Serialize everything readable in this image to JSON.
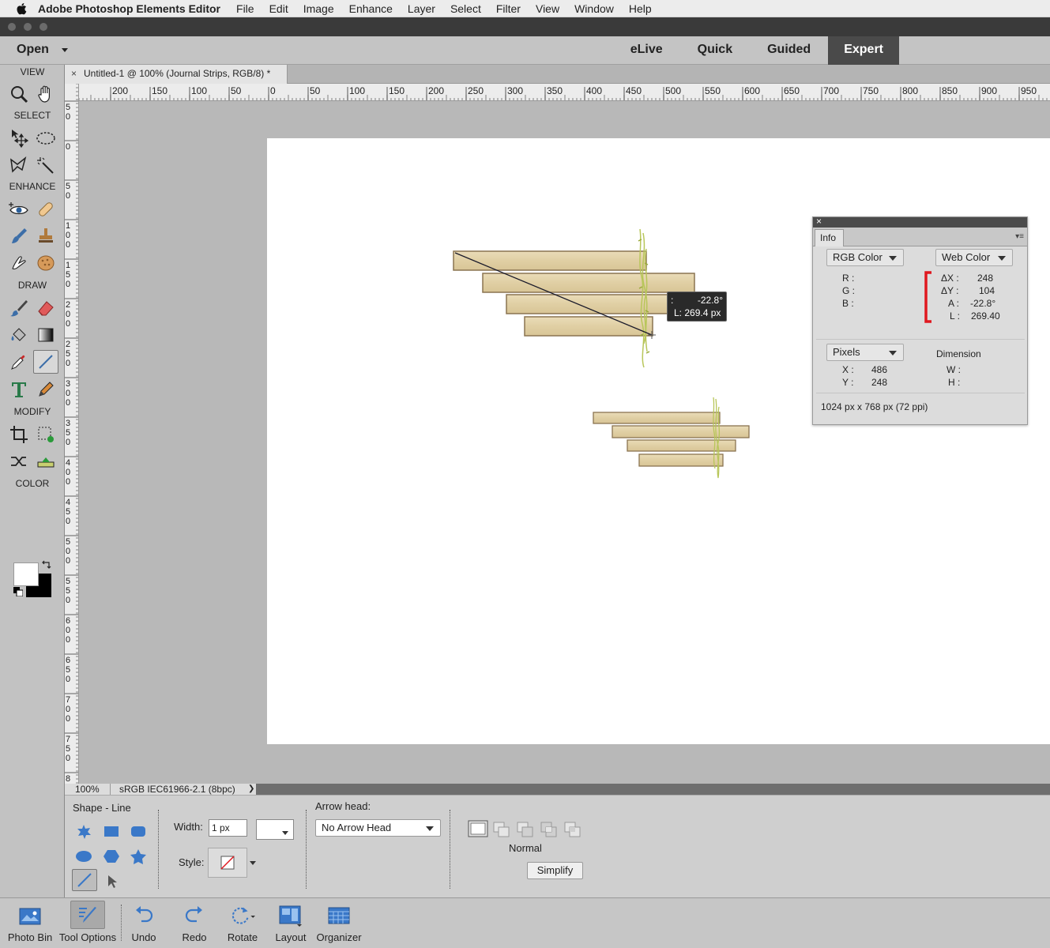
{
  "menubar": {
    "app_name": "Adobe Photoshop Elements Editor",
    "items": [
      "File",
      "Edit",
      "Image",
      "Enhance",
      "Layer",
      "Select",
      "Filter",
      "View",
      "Window",
      "Help"
    ]
  },
  "topbar": {
    "open_label": "Open",
    "modes": [
      "eLive",
      "Quick",
      "Guided",
      "Expert"
    ],
    "active_mode": "Expert"
  },
  "toolbox": {
    "sections": {
      "view": "VIEW",
      "select": "SELECT",
      "enhance": "ENHANCE",
      "draw": "DRAW",
      "modify": "MODIFY",
      "color": "COLOR"
    }
  },
  "document": {
    "tab_label": "Untitled-1 @ 100% (Journal Strips, RGB/8) *"
  },
  "rulers": {
    "horizontal": [
      "200",
      "150",
      "100",
      "50",
      "0",
      "50",
      "100",
      "150",
      "200",
      "250",
      "300",
      "350",
      "400",
      "450",
      "500",
      "550",
      "600",
      "650",
      "700",
      "750",
      "800",
      "850",
      "900",
      "950"
    ],
    "vertical": [
      [
        "5",
        "0"
      ],
      [
        "0"
      ],
      [
        "5",
        "0"
      ],
      [
        "1",
        "0",
        "0"
      ],
      [
        "1",
        "5",
        "0"
      ],
      [
        "2",
        "0",
        "0"
      ],
      [
        "2",
        "5",
        "0"
      ],
      [
        "3",
        "0",
        "0"
      ],
      [
        "3",
        "5",
        "0"
      ],
      [
        "4",
        "0",
        "0"
      ],
      [
        "4",
        "5",
        "0"
      ],
      [
        "5",
        "0",
        "0"
      ],
      [
        "5",
        "5",
        "0"
      ],
      [
        "6",
        "0",
        "0"
      ],
      [
        "6",
        "5",
        "0"
      ],
      [
        "7",
        "0",
        "0"
      ],
      [
        "7",
        "5",
        "0"
      ],
      [
        "8"
      ]
    ]
  },
  "measure_tooltip": {
    "angle": "-22.8°",
    "angle_prefix": ":",
    "length": "L: 269.4 px"
  },
  "info_panel": {
    "tab": "Info",
    "color_mode_1": "RGB Color",
    "color_mode_2": "Web Color",
    "r_label": "R :",
    "g_label": "G :",
    "b_label": "B :",
    "dx_label": "ΔX :",
    "dx_value": "248",
    "dy_label": "ΔY :",
    "dy_value": "104",
    "a_label": "A :",
    "a_value": "-22.8°",
    "l_label": "L :",
    "l_value": "269.40",
    "units": "Pixels",
    "dimension_label": "Dimension",
    "x_label": "X :",
    "x_value": "486",
    "y_label": "Y :",
    "y_value": "248",
    "w_label": "W :",
    "h_label": "H :",
    "doc_size": "1024 px x 768 px (72 ppi)"
  },
  "statusbar": {
    "zoom": "100%",
    "profile": "sRGB IEC61966-2.1 (8bpc)"
  },
  "tool_options": {
    "title": "Shape - Line",
    "width_label": "Width:",
    "width_value": "1 px",
    "style_label": "Style:",
    "arrow_head_label": "Arrow head:",
    "arrow_head_value": "No Arrow Head",
    "mode_label": "Normal",
    "simplify_label": "Simplify"
  },
  "bottombar": {
    "items": [
      "Photo Bin",
      "Tool Options",
      "Undo",
      "Redo",
      "Rotate",
      "Layout",
      "Organizer"
    ]
  },
  "colors": {
    "accent_red": "#e0181f",
    "strip_fill": "#e3d3ad",
    "strip_border": "#8a7450"
  }
}
